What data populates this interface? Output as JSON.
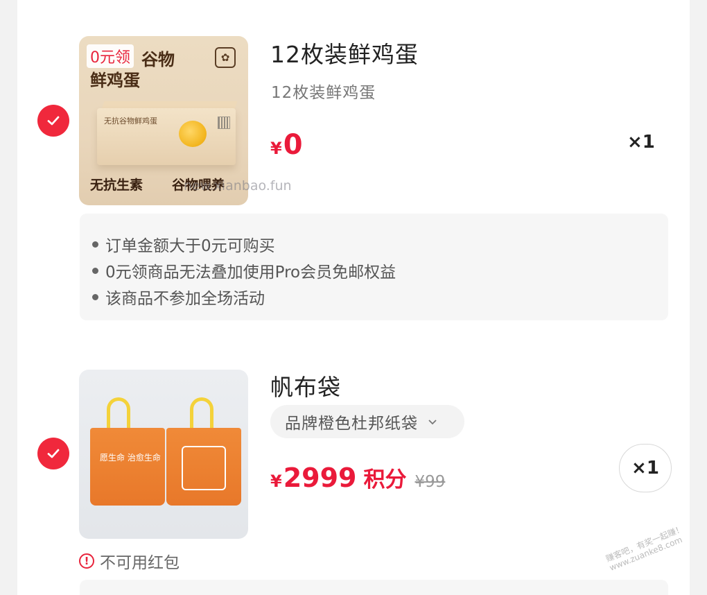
{
  "item1": {
    "image_tag": "0元领",
    "image_headline_line1": "谷物",
    "image_headline_line2": "鲜鸡蛋",
    "image_box_text": "无抗谷物鲜鸡蛋",
    "image_badge_left": "无抗生素",
    "image_badge_right": "谷物喂养",
    "title": "12枚装鲜鸡蛋",
    "spec": "12枚装鲜鸡蛋",
    "price_symbol": "¥",
    "price": "0",
    "quantity": "×1",
    "notes": [
      "订单金额大于0元可购买",
      "0元领商品无法叠加使用Pro会员免邮权益",
      "该商品不参加全场活动"
    ]
  },
  "item2": {
    "image_bag_text": "愿生命 治愈生命",
    "title": "帆布袋",
    "variant": "品牌橙色杜邦纸袋",
    "price_symbol": "¥",
    "price": "2999",
    "price_unit": "积分",
    "original_price": "¥99",
    "quantity": "×1",
    "warning": "不可用红包"
  },
  "watermark": "new.xianbao.fun",
  "watermark_corner": "赚客吧，有奖一起赚！www.zuanke8.com",
  "colors": {
    "accent": "#ea1a3a",
    "check": "#f0283c",
    "card": "#ffffff",
    "note_bg": "#f6f6f6"
  }
}
